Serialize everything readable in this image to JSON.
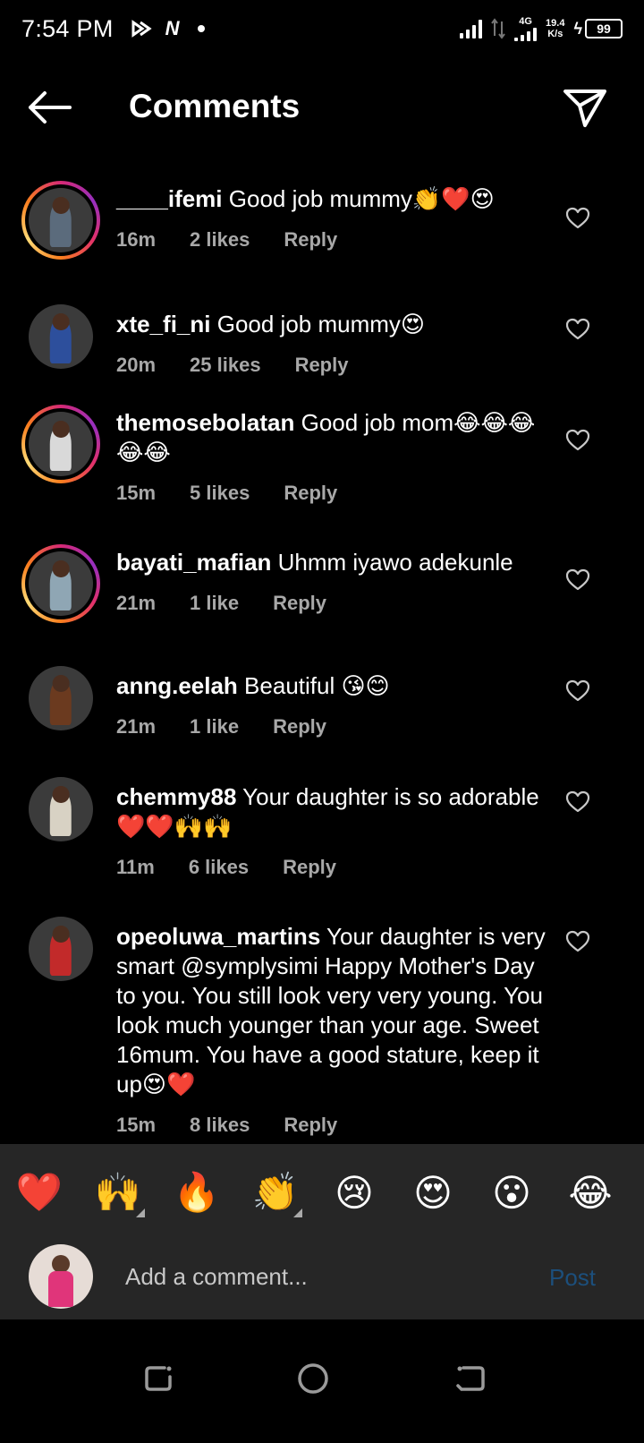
{
  "status_bar": {
    "time": "7:54 PM",
    "network_type": "4G",
    "speed_value": "19.4",
    "speed_unit": "K/s",
    "battery": "99"
  },
  "header": {
    "title": "Comments",
    "back_icon": "arrow-left-icon",
    "send_icon": "paper-plane-icon"
  },
  "comments": [
    {
      "username": "____ifemi",
      "text": " Good job mummy👏❤️😍",
      "time": "16m",
      "likes": "2 likes",
      "reply": "Reply",
      "ring": true,
      "avatar_color": "#5b6b7c"
    },
    {
      "username": "xte_fi_ni",
      "text": " Good job mummy😍",
      "time": "20m",
      "likes": "25 likes",
      "reply": "Reply",
      "ring": false,
      "avatar_color": "#2d4f9c"
    },
    {
      "username": "themosebolatan",
      "text": " Good job mom😂😂😂😂😂",
      "time": "15m",
      "likes": "5 likes",
      "reply": "Reply",
      "ring": true,
      "avatar_color": "#d9d9d9"
    },
    {
      "username": "bayati_mafian",
      "text": " Uhmm iyawo adekunle",
      "time": "21m",
      "likes": "1 like",
      "reply": "Reply",
      "ring": true,
      "avatar_color": "#8fa6b4"
    },
    {
      "username": "anng.eelah",
      "text": " Beautiful 😘😊",
      "time": "21m",
      "likes": "1 like",
      "reply": "Reply",
      "ring": false,
      "avatar_color": "#6b3a1f"
    },
    {
      "username": "chemmy88",
      "text": " Your daughter is so adorable ❤️❤️🙌🙌",
      "time": "11m",
      "likes": "6 likes",
      "reply": "Reply",
      "ring": false,
      "avatar_color": "#d8d2c4"
    },
    {
      "username": "opeoluwa_martins",
      "text": " Your daughter is very smart @symplysimi  Happy Mother's Day to you. You still look very very young. You look much younger than your age. Sweet 16mum. You have a good stature, keep it up😍❤️",
      "time": "15m",
      "likes": "8 likes",
      "reply": "Reply",
      "ring": false,
      "avatar_color": "#c22a2a"
    }
  ],
  "reactions": [
    "❤️",
    "🙌",
    "🔥",
    "👏",
    "😢",
    "😍",
    "😮",
    "😂"
  ],
  "composer": {
    "placeholder": "Add a comment...",
    "post_label": "Post",
    "post_color": "#1c4f7c"
  },
  "nav": {
    "recents_icon": "recents-icon",
    "home_icon": "home-circle-icon",
    "back_icon": "nav-back-icon"
  }
}
